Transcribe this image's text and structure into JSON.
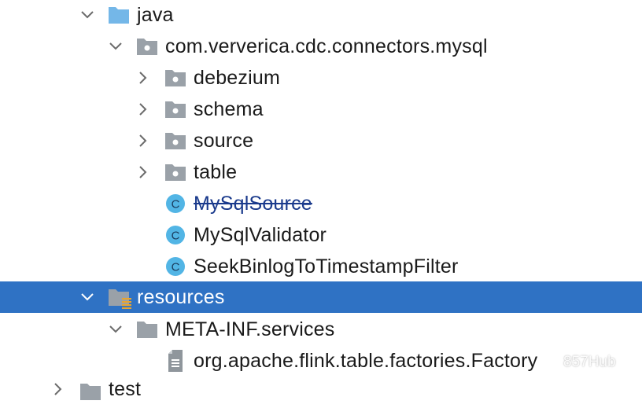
{
  "tree": {
    "java_label": "java",
    "package_label": "com.ververica.cdc.connectors.mysql",
    "debezium_label": "debezium",
    "schema_label": "schema",
    "source_label": "source",
    "table_label": "table",
    "class_mysqlsource": "MySqlSource",
    "class_mysqlvalidator": "MySqlValidator",
    "class_seekbinlog": "SeekBinlogToTimestampFilter",
    "resources_label": "resources",
    "metainf_label": "META-INF.services",
    "factory_file_label": "org.apache.flink.table.factories.Factory",
    "test_label": "test"
  },
  "watermark": {
    "text": "857Hub"
  },
  "colors": {
    "selection": "#2f72c4",
    "folder_blue": "#74b7e8",
    "package_gray": "#9aa1a8",
    "class_circle": "#52b5e5",
    "deprecated_text": "#1a3a8c"
  }
}
